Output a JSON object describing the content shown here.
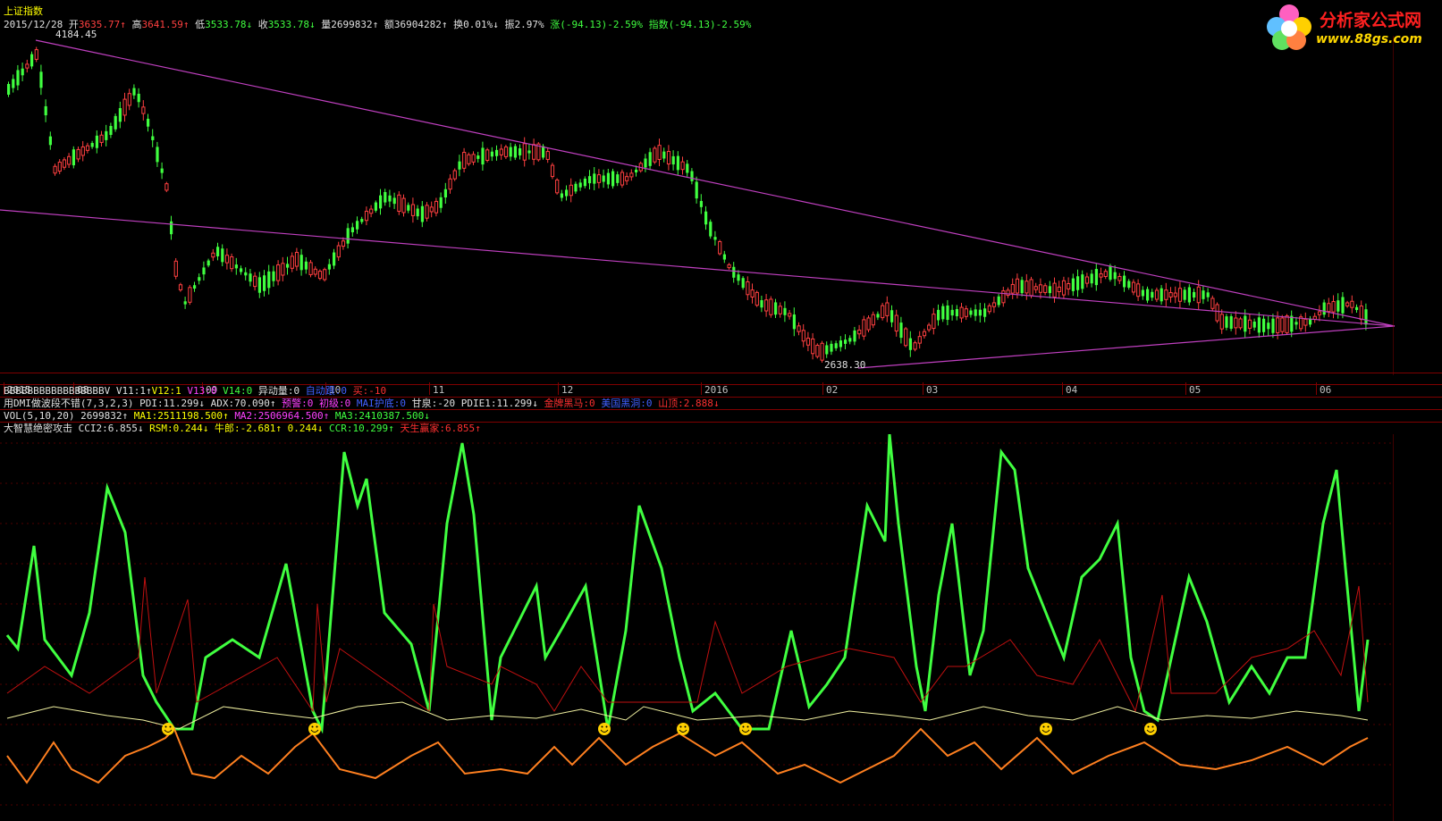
{
  "window": {
    "title": "上证指数"
  },
  "quote": {
    "date": "2015/12/28",
    "open_label": "开",
    "open": "3635.77",
    "high_label": "高",
    "high": "3641.59",
    "low_label": "低",
    "low": "3533.78",
    "close_label": "收",
    "close": "3533.78",
    "vol_label": "量",
    "vol": "2699832",
    "amt_label": "额",
    "amt": "36904282",
    "turn_label": "换",
    "turn": "0.01%",
    "amp_label": "振",
    "amp": "2.97%",
    "chg_label": "涨",
    "chg": "(-94.13)-2.59%",
    "idx_label": "指数",
    "idx": "(-94.13)-2.59%"
  },
  "chart_labels": {
    "high_mark": "4184.45",
    "low_mark": "2638.30"
  },
  "dates": [
    "2015",
    "08",
    "09",
    "10",
    "11",
    "12",
    "2016",
    "02",
    "03",
    "04",
    "05",
    "06"
  ],
  "indicators": {
    "row1": {
      "name": "BBBBBBBBBBBBBBBBBV",
      "v11": "V11:1",
      "v12": "V12:1",
      "v13": "V13:0",
      "v14": "V14:0",
      "yd": "异动量:0",
      "zd": "自动跟:0",
      "buy": "买:-10"
    },
    "row2": {
      "name": "用DMI做波段不错(7,3,2,3)",
      "pdi": "PDI:11.299",
      "adx": "ADX:70.090",
      "warn": "预警:0",
      "chuji": "初级:0",
      "maipaoji": "MAI护底:0",
      "ganquan": "甘泉:-20",
      "pdie1": "PDIE1:11.299",
      "jinma": "金牌黑马:0",
      "meiguo": "美国黑洞:0",
      "shanding": "山顶:2.888"
    },
    "row3": {
      "name": "VOL(5,10,20)",
      "vol": "2699832",
      "ma1": "MA1:2511198.500",
      "ma2": "MA2:2506964.500",
      "ma3": "MA3:2410387.500"
    },
    "row4": {
      "name": "大智慧绝密攻击",
      "cci2": "CCI2:6.855",
      "rsm": "RSM:0.244",
      "niulang": "牛郎:-2.681",
      "v": "0.244",
      "ccr": "CCR:10.299",
      "tiansheng": "天生赢家:6.855"
    }
  },
  "logo": {
    "text": "分析家公式网",
    "url": "www.88gs.com"
  },
  "colors": {
    "up": "#ff4040",
    "down": "#40ff40",
    "trendline": "#c040c0",
    "green_line": "#40ff40",
    "red_line": "#c01010",
    "yellow_line": "#f0f0a0",
    "orange_line": "#ff8020",
    "smiley": "#ffd000"
  }
}
